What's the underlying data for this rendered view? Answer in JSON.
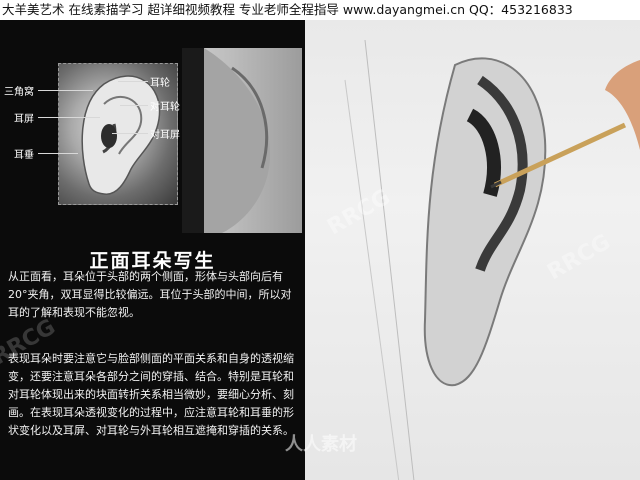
{
  "header": {
    "banner": "大羊美艺术 在线素描学习 超详细视频教程 专业老师全程指导  www.dayangmei.cn  QQ：453216833"
  },
  "diagram": {
    "labels": {
      "triangle_fossa": "三角窝",
      "helix": "耳轮",
      "antihelix": "对耳轮",
      "tragus": "耳屏",
      "antitragus": "对耳屏",
      "earlobe": "耳垂"
    }
  },
  "lesson": {
    "title": "正面耳朵写生",
    "paragraph1": "从正面看，耳朵位于头部的两个侧面，形体与头部向后有20°夹角，双耳显得比较偏远。耳位于头部的中间，所以对耳的了解和表现不能忽视。",
    "paragraph2": "表现耳朵时要注意它与脸部侧面的平面关系和自身的透视缩变，还要注意耳朵各部分之间的穿插、结合。特别是耳轮和对耳轮体现出来的块面转折关系相当微妙，要细心分析、刻画。在表现耳朵透视变化的过程中，应注意耳轮和耳垂的形状变化以及耳屏、对耳轮与外耳轮相互遮掩和穿插的关系。"
  },
  "watermarks": {
    "rrcg": "RRCG",
    "renren": "人人素材"
  }
}
